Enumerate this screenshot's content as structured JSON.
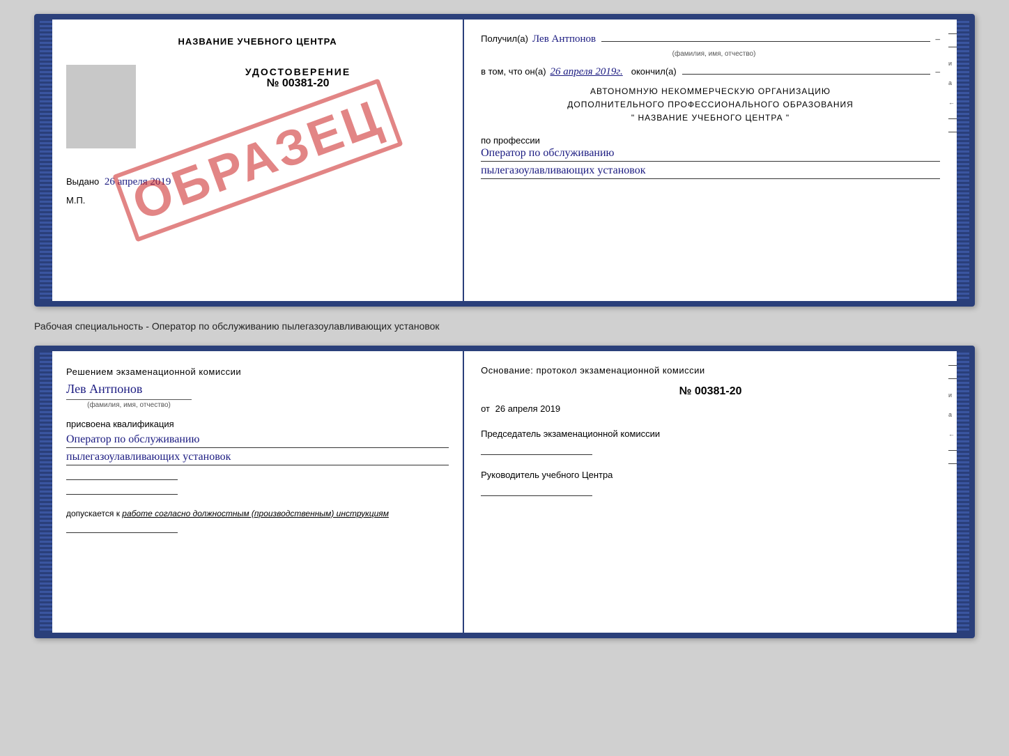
{
  "top_booklet": {
    "left": {
      "title": "НАЗВАНИЕ УЧЕБНОГО ЦЕНТРА",
      "stamp_text": "ОБРАЗЕЦ",
      "udostoverenie_label": "УДОСТОВЕРЕНИЕ",
      "number": "№ 00381-20",
      "vydano_label": "Выдано",
      "vydano_date": "26 апреля 2019",
      "mp_label": "М.П."
    },
    "right": {
      "poluchil_label": "Получил(а)",
      "poluchil_name": "Лев Антпонов",
      "fio_subtext": "(фамилия, имя, отчество)",
      "v_tom_label": "в том, что он(а)",
      "v_tom_date": "26 апреля 2019г.",
      "okonchil_label": "окончил(а)",
      "org_line1": "АВТОНОМНУЮ НЕКОММЕРЧЕСКУЮ ОРГАНИЗАЦИЮ",
      "org_line2": "ДОПОЛНИТЕЛЬНОГО ПРОФЕССИОНАЛЬНОГО ОБРАЗОВАНИЯ",
      "org_line3": "\"   НАЗВАНИЕ УЧЕБНОГО ЦЕНТРА   \"",
      "po_professii_label": "по профессии",
      "profession_line1": "Оператор по обслуживанию",
      "profession_line2": "пылегазоулавливающих установок"
    }
  },
  "separator": {
    "text": "Рабочая специальность - Оператор по обслуживанию пылегазоулавливающих установок"
  },
  "bottom_booklet": {
    "left": {
      "resheniem_label": "Решением экзаменационной комиссии",
      "name_handwritten": "Лев Антпонов",
      "fio_subtext": "(фамилия, имя, отчество)",
      "prisvoena_label": "присвоена квалификация",
      "qualification_line1": "Оператор по обслуживанию",
      "qualification_line2": "пылегазоулавливающих установок",
      "dopuskaetsya_label": "допускается к",
      "dopuskaetsya_value": "работе согласно должностным (производственным) инструкциям"
    },
    "right": {
      "osnovanie_label": "Основание: протокол экзаменационной комиссии",
      "number": "№ 00381-20",
      "ot_label": "от",
      "ot_date": "26 апреля 2019",
      "predsedatel_label": "Председатель экзаменационной комиссии",
      "rukovoditel_label": "Руководитель учебного Центра"
    }
  }
}
